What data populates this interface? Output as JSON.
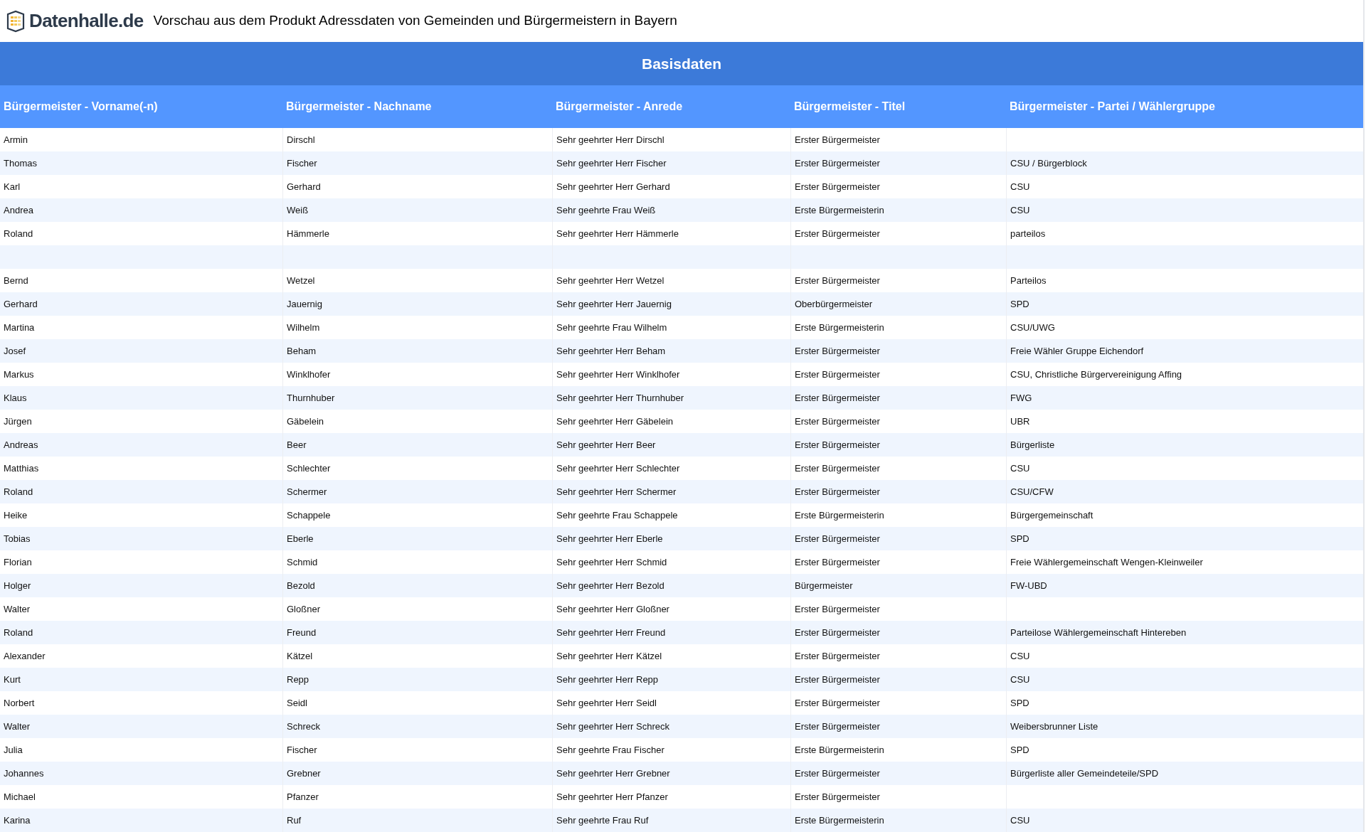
{
  "header": {
    "logo_text": "Datenhalle.de",
    "title": "Vorschau aus dem Produkt Adressdaten von Gemeinden und Bürgermeistern in Bayern"
  },
  "table": {
    "group_heading": "Basisdaten",
    "columns": [
      "Bürgermeister - Vorname(-n)",
      "Bürgermeister - Nachname",
      "Bürgermeister - Anrede",
      "Bürgermeister - Titel",
      "Bürgermeister - Partei / Wählergruppe"
    ],
    "rows": [
      {
        "first_name": "Armin",
        "last_name": "Dirschl",
        "salutation": "Sehr geehrter Herr Dirschl",
        "title": "Erster Bürgermeister"
      },
      {
        "first_name": "Thomas",
        "last_name": "Fischer",
        "salutation": "Sehr geehrter Herr Fischer",
        "title": "Erster Bürgermeister",
        "party": "CSU / Bürgerblock"
      },
      {
        "first_name": "Karl",
        "last_name": "Gerhard",
        "salutation": "Sehr geehrter Herr Gerhard",
        "title": "Erster Bürgermeister",
        "party": "CSU"
      },
      {
        "first_name": "Andrea",
        "last_name": "Weiß",
        "salutation": "Sehr geehrte Frau Weiß",
        "title": "Erste Bürgermeisterin",
        "party": "CSU"
      },
      {
        "first_name": "Roland",
        "last_name": "Hämmerle",
        "salutation": "Sehr geehrter Herr Hämmerle",
        "title": "Erster Bürgermeister",
        "party": "parteilos"
      },
      {},
      {
        "first_name": "Bernd",
        "last_name": "Wetzel",
        "salutation": "Sehr geehrter Herr Wetzel",
        "title": "Erster Bürgermeister",
        "party": "Parteilos"
      },
      {
        "first_name": "Gerhard",
        "last_name": "Jauernig",
        "salutation": "Sehr geehrter Herr Jauernig",
        "title": "Oberbürgermeister",
        "party": "SPD"
      },
      {
        "first_name": "Martina",
        "last_name": "Wilhelm",
        "salutation": "Sehr geehrte Frau Wilhelm",
        "title": "Erste Bürgermeisterin",
        "party": "CSU/UWG"
      },
      {
        "first_name": "Josef",
        "last_name": "Beham",
        "salutation": "Sehr geehrter Herr Beham",
        "title": "Erster Bürgermeister",
        "party": "Freie Wähler Gruppe Eichendorf"
      },
      {
        "first_name": "Markus",
        "last_name": "Winklhofer",
        "salutation": "Sehr geehrter Herr Winklhofer",
        "title": "Erster Bürgermeister",
        "party": "CSU, Christliche Bürgervereinigung Affing"
      },
      {
        "first_name": "Klaus",
        "last_name": "Thurnhuber",
        "salutation": "Sehr geehrter Herr Thurnhuber",
        "title": "Erster Bürgermeister",
        "party": "FWG"
      },
      {
        "first_name": "Jürgen",
        "last_name": "Gäbelein",
        "salutation": "Sehr geehrter Herr Gäbelein",
        "title": "Erster Bürgermeister",
        "party": "UBR"
      },
      {
        "first_name": "Andreas",
        "last_name": "Beer",
        "salutation": "Sehr geehrter Herr Beer",
        "title": "Erster Bürgermeister",
        "party": "Bürgerliste"
      },
      {
        "first_name": "Matthias",
        "last_name": "Schlechter",
        "salutation": "Sehr geehrter Herr Schlechter",
        "title": "Erster Bürgermeister",
        "party": "CSU"
      },
      {
        "first_name": "Roland",
        "last_name": "Schermer",
        "salutation": "Sehr geehrter Herr Schermer",
        "title": "Erster Bürgermeister",
        "party": "CSU/CFW"
      },
      {
        "first_name": "Heike",
        "last_name": "Schappele",
        "salutation": "Sehr geehrte Frau Schappele",
        "title": "Erste Bürgermeisterin",
        "party": "Bürgergemeinschaft"
      },
      {
        "first_name": "Tobias",
        "last_name": "Eberle",
        "salutation": "Sehr geehrter Herr Eberle",
        "title": "Erster Bürgermeister",
        "party": "SPD"
      },
      {
        "first_name": "Florian",
        "last_name": "Schmid",
        "salutation": "Sehr geehrter Herr Schmid",
        "title": "Erster Bürgermeister",
        "party": "Freie Wählergemeinschaft Wengen-Kleinweiler"
      },
      {
        "first_name": "Holger",
        "last_name": "Bezold",
        "salutation": "Sehr geehrter Herr Bezold",
        "title": "Bürgermeister",
        "party": "FW-UBD"
      },
      {
        "first_name": "Walter",
        "last_name": "Gloßner",
        "salutation": "Sehr geehrter Herr Gloßner",
        "title": "Erster Bürgermeister"
      },
      {
        "first_name": "Roland",
        "last_name": "Freund",
        "salutation": "Sehr geehrter Herr Freund",
        "title": "Erster Bürgermeister",
        "party": "Parteilose Wählergemeinschaft Hintereben"
      },
      {
        "first_name": "Alexander",
        "last_name": "Kätzel",
        "salutation": "Sehr geehrter Herr Kätzel",
        "title": "Erster Bürgermeister",
        "party": "CSU"
      },
      {
        "first_name": "Kurt",
        "last_name": "Repp",
        "salutation": "Sehr geehrter Herr Repp",
        "title": "Erster Bürgermeister",
        "party": "CSU"
      },
      {
        "first_name": "Norbert",
        "last_name": "Seidl",
        "salutation": "Sehr geehrter Herr Seidl",
        "title": "Erster Bürgermeister",
        "party": "SPD"
      },
      {
        "first_name": "Walter",
        "last_name": "Schreck",
        "salutation": "Sehr geehrter Herr Schreck",
        "title": "Erster Bürgermeister",
        "party": "Weibersbrunner Liste"
      },
      {
        "first_name": "Julia",
        "last_name": "Fischer",
        "salutation": "Sehr geehrte Frau Fischer",
        "title": "Erste Bürgermeisterin",
        "party": "SPD"
      },
      {
        "first_name": "Johannes",
        "last_name": "Grebner",
        "salutation": "Sehr geehrter Herr Grebner",
        "title": "Erster Bürgermeister",
        "party": "Bürgerliste aller Gemeindeteile/SPD"
      },
      {
        "first_name": "Michael",
        "last_name": "Pfanzer",
        "salutation": "Sehr geehrter Herr Pfanzer",
        "title": "Erster Bürgermeister"
      },
      {
        "first_name": "Karina",
        "last_name": "Ruf",
        "salutation": "Sehr geehrte Frau Ruf",
        "title": "Erste Bürgermeisterin",
        "party": "CSU"
      }
    ]
  }
}
